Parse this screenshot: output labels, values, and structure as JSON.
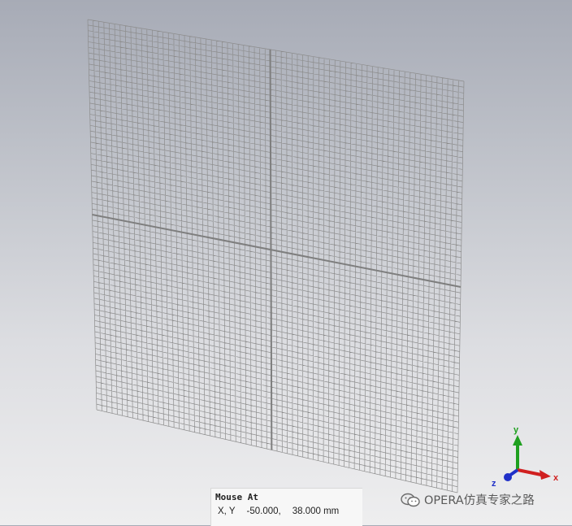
{
  "viewport": {
    "background_top": "#a7abb6",
    "background_bottom": "#eeeeef",
    "mesh_color": "#8c8c8c",
    "mesh_divider_color": "#7e7e7e"
  },
  "readout": {
    "title": "Mouse At",
    "xy_label": "X, Y",
    "x_value": "-50.000,",
    "y_value": "38.000 mm"
  },
  "axes_triad": {
    "x_label": "x",
    "y_label": "y",
    "z_label": "z",
    "x_color": "#d02020",
    "y_color": "#1fa01f",
    "z_color": "#2030c8"
  },
  "watermark": {
    "text": "OPERA仿真专家之路",
    "icon": "wechat-icon"
  }
}
